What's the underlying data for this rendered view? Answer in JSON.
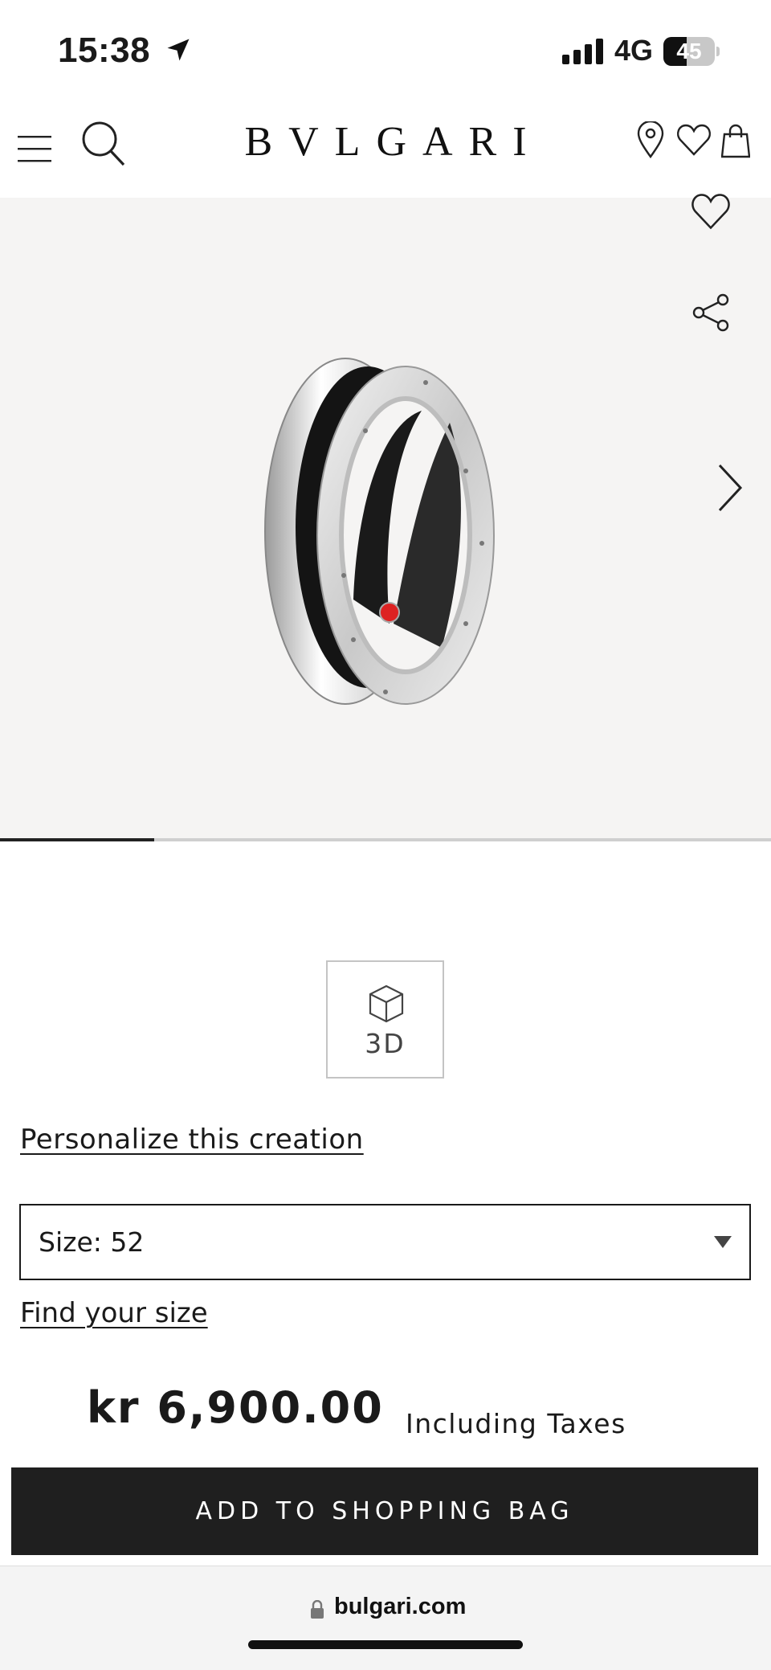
{
  "status_bar": {
    "time": "15:38",
    "network": "4G",
    "battery_level": "45",
    "icons": [
      "location-arrow-icon",
      "signal-bars-icon",
      "battery-icon"
    ]
  },
  "header": {
    "brand": "BVLGARI",
    "icons": [
      "menu-icon",
      "search-icon",
      "store-locator-icon",
      "wishlist-icon",
      "shopping-bag-icon"
    ]
  },
  "gallery": {
    "image_description_icon": "product-image-ring",
    "icons": [
      "wishlist-icon",
      "share-icon",
      "chevron-right-icon"
    ],
    "progress_fraction": 0.2
  },
  "view_3d": {
    "label": "3D",
    "icon": "cube-icon"
  },
  "personalize_link": "Personalize this creation",
  "size_select": {
    "selected": "Size: 52"
  },
  "find_size_link": "Find your size",
  "price": {
    "amount": "kr 6,900.00",
    "tax_note": "Including Taxes"
  },
  "add_to_bag": "ADD TO SHOPPING BAG",
  "browser": {
    "url": "bulgari.com"
  },
  "colors": {
    "button_bg": "#1f1f1f",
    "gallery_bg": "#f5f4f3",
    "text": "#1a1a1a"
  }
}
